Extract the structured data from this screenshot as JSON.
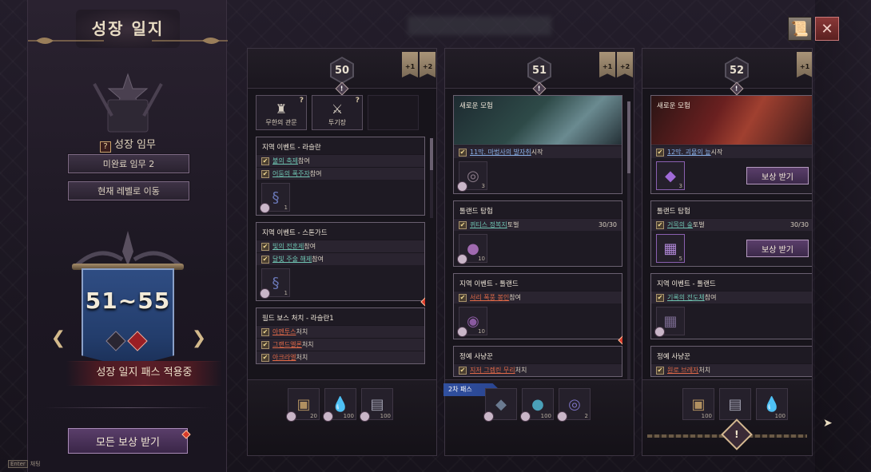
{
  "left": {
    "title": "성장 일지",
    "growth_task_label": "성장 임무",
    "q_icon": "?",
    "incomplete_btn": "미완료 임무 2",
    "goto_level_btn": "현재 레벨로 이동",
    "level_range": "51~55",
    "pass_status": "성장 일지 패스 적용중",
    "claim_all_btn": "모든 보상 받기",
    "enter_key": "Enter",
    "enter_hint": "채팅",
    "arrow_left": "❮",
    "arrow_right": "❯"
  },
  "topbar": {
    "book_icon": "📜",
    "close_icon": "✕"
  },
  "columns": [
    {
      "level": "50",
      "alert": "!",
      "bonus": [
        "+1",
        "+2"
      ],
      "tiles": [
        {
          "label": "무한의 관문",
          "icon": "♜",
          "q": "?"
        },
        {
          "label": "투기장",
          "icon": "⚔",
          "q": "?"
        }
      ],
      "cards": [
        {
          "title": "지역 이벤트 - 라슬란",
          "tasks": [
            {
              "hl": "불의 축제",
              "rest": " 참여"
            },
            {
              "hl": "어둠의 폭주자",
              "rest": " 참여"
            }
          ],
          "reward_qty": "1"
        },
        {
          "title": "지역 이벤트 - 스톤가드",
          "tasks": [
            {
              "hl": "빛의 전혼제",
              "rest": " 참여"
            },
            {
              "hl": "달빛 주술 해제",
              "rest": " 참여"
            }
          ],
          "reward_qty": "1"
        },
        {
          "title": "필드 보스 처치 - 라슬란1",
          "tasks": [
            {
              "hl": "아멘투스",
              "rest": " 처치"
            },
            {
              "hl": "그랜드엘론",
              "rest": " 처치"
            },
            {
              "hl": "아크라엘",
              "rest": " 처치"
            }
          ]
        }
      ],
      "footer_qty": [
        "20",
        "100",
        "100"
      ]
    },
    {
      "level": "51",
      "alert": "!",
      "bonus": [
        "+1",
        "+2"
      ],
      "cards": [
        {
          "title": "새로운 모험",
          "task": {
            "hl": "11막. 마법사의 발자취",
            "rest": " 시작"
          },
          "reward_qty": "3"
        },
        {
          "title": "톨랜드 탐험",
          "task": {
            "hl": "퀴티스 정복지",
            "rest": " 토벌",
            "count": "30/30"
          },
          "reward_qty": "10"
        },
        {
          "title": "지역 이벤트 - 톨랜드",
          "task": {
            "hl": "서리 폭풍 봉인",
            "rest": " 참여"
          },
          "reward_qty": "10"
        },
        {
          "title": "정예 사냥꾼",
          "task": {
            "hl": "지저 그렘린 무리",
            "rest": " 처치"
          }
        }
      ],
      "pass2": "2차 패스",
      "footer_qty": [
        "",
        "100",
        "2"
      ]
    },
    {
      "level": "52",
      "alert": "!",
      "bonus": [
        "+1"
      ],
      "cards": [
        {
          "title": "새로운 모험",
          "task": {
            "hl": "12막. 괴물의 늪",
            "rest": " 시작"
          },
          "reward_qty": "3",
          "claim": "보상 받기"
        },
        {
          "title": "톨랜드 탐험",
          "task": {
            "hl": "거목의 숲",
            "rest": " 토벌",
            "count": "30/30"
          },
          "reward_qty": "5",
          "claim": "보상 받기"
        },
        {
          "title": "지역 이벤트 - 톨랜드",
          "task": {
            "hl": "기록의 전도체",
            "rest": " 참여"
          },
          "reward_qty": ""
        },
        {
          "title": "정예 사냥꾼",
          "task": {
            "hl": "원로 브레자",
            "rest": " 처치"
          }
        }
      ],
      "footer_qty": [
        "100",
        "",
        "100"
      ],
      "footer_alert": "!"
    }
  ],
  "colors": {
    "accent_purple": "#5a3e6a",
    "banner_blue": "#2f4d83",
    "highlight_teal": "#6fc4b2",
    "highlight_red": "#e36a48",
    "alert_red": "#d83a2a"
  },
  "check": "✔"
}
